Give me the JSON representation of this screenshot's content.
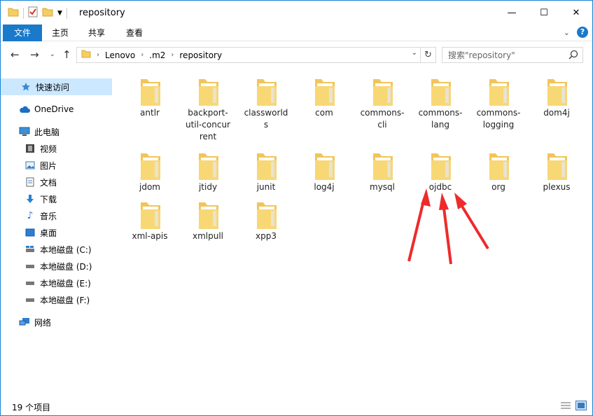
{
  "window": {
    "title": "repository",
    "minimize": "—",
    "maximize": "☐",
    "close": "✕"
  },
  "ribbon": {
    "tabs": [
      "文件",
      "主页",
      "共享",
      "查看"
    ]
  },
  "address": {
    "crumbs": [
      "Lenovo",
      ".m2",
      "repository"
    ]
  },
  "search": {
    "placeholder": "搜索\"repository\""
  },
  "nav": {
    "quick_access": "快速访问",
    "onedrive": "OneDrive",
    "this_pc": "此电脑",
    "videos": "视频",
    "pictures": "图片",
    "documents": "文档",
    "downloads": "下载",
    "music": "音乐",
    "desktop": "桌面",
    "drive_c": "本地磁盘 (C:)",
    "drive_d": "本地磁盘 (D:)",
    "drive_e": "本地磁盘 (E:)",
    "drive_f": "本地磁盘 (F:)",
    "network": "网络"
  },
  "folders": [
    "antlr",
    "backport-util-concurrent",
    "classworlds",
    "com",
    "commons-cli",
    "commons-lang",
    "commons-logging",
    "dom4j",
    "jdom",
    "jtidy",
    "junit",
    "log4j",
    "mysql",
    "ojdbc",
    "org",
    "plexus",
    "xml-apis",
    "xmlpull",
    "xpp3"
  ],
  "folder_labels": {
    "backport": "backport-\nutil-concur\nrent",
    "classworlds": "classworld\ns",
    "commons_cli": "commons-\ncli",
    "commons_lang": "commons-\nlang",
    "commons_logging": "commons-\nlogging"
  },
  "status": {
    "count": "19 个项目"
  },
  "colors": {
    "accent": "#1979ca",
    "selection": "#cce8ff",
    "annotation": "#ee2b2b"
  }
}
